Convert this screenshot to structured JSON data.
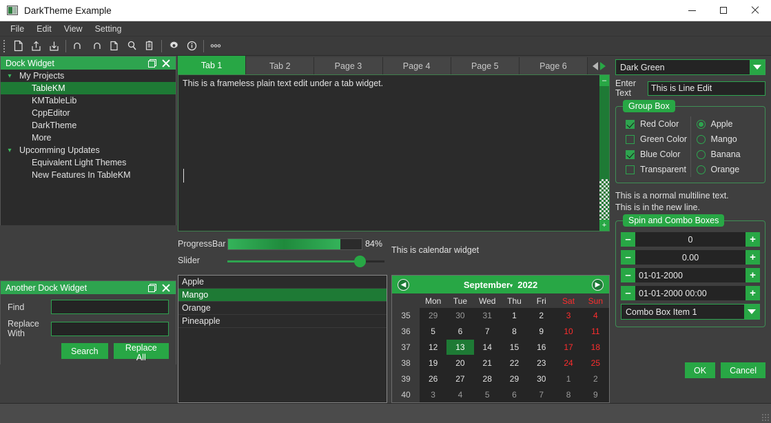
{
  "window": {
    "title": "DarkTheme Example",
    "app_icon": "app-icon",
    "minimize": "minimize-icon",
    "maximize": "maximize-icon",
    "close": "close-icon"
  },
  "menubar": {
    "items": [
      "File",
      "Edit",
      "View",
      "Setting"
    ]
  },
  "toolbar": {
    "icons": [
      "new-file-icon",
      "upload-icon",
      "download-icon",
      "undo-icon",
      "redo-icon",
      "copy-icon",
      "search-icon",
      "paste-icon",
      "gear-icon",
      "info-icon",
      "more-icon"
    ]
  },
  "dock_projects": {
    "title": "Dock Widget",
    "tree": [
      {
        "label": "My Projects",
        "level": 0,
        "expanded": true,
        "selected": false
      },
      {
        "label": "TableKM",
        "level": 1,
        "expanded": false,
        "selected": true
      },
      {
        "label": "KMTableLib",
        "level": 1,
        "expanded": false,
        "selected": false
      },
      {
        "label": "CppEditor",
        "level": 1,
        "expanded": false,
        "selected": false
      },
      {
        "label": "DarkTheme",
        "level": 1,
        "expanded": false,
        "selected": false
      },
      {
        "label": "More",
        "level": 1,
        "expanded": false,
        "selected": false
      },
      {
        "label": "Upcomming Updates",
        "level": 0,
        "expanded": true,
        "selected": false
      },
      {
        "label": "Equivalent Light Themes",
        "level": 1,
        "expanded": false,
        "selected": false
      },
      {
        "label": "New Features In TableKM",
        "level": 1,
        "expanded": false,
        "selected": false
      }
    ]
  },
  "dock_find": {
    "title": "Another Dock Widget",
    "find_label": "Find",
    "find_value": "",
    "replace_label": "Replace With",
    "replace_value": "",
    "search_button": "Search",
    "replace_all_button": "Replace All"
  },
  "tabs": {
    "items": [
      {
        "label": "Tab 1",
        "active": true
      },
      {
        "label": "Tab 2",
        "active": false
      },
      {
        "label": "Page 3",
        "active": false
      },
      {
        "label": "Page 4",
        "active": false
      },
      {
        "label": "Page 5",
        "active": false
      },
      {
        "label": "Page 6",
        "active": false
      }
    ],
    "nav_prev": "tab-scroll-left-icon",
    "nav_next": "tab-scroll-right-icon"
  },
  "text_edit": {
    "content": "This is a frameless plain text edit under a tab widget."
  },
  "scrollbar": {
    "decrement": "–",
    "increment": "+"
  },
  "progress": {
    "label": "ProgressBar",
    "value": 84,
    "value_text": "84%"
  },
  "slider": {
    "label": "Slider",
    "value": 84
  },
  "calendar_caption": "This is  calendar widget",
  "list_widget": {
    "items": [
      {
        "label": "Apple",
        "selected": false
      },
      {
        "label": "Mango",
        "selected": true
      },
      {
        "label": "Orange",
        "selected": false
      },
      {
        "label": "Pineapple",
        "selected": false
      }
    ]
  },
  "calendar": {
    "prev_icon": "calendar-prev-icon",
    "next_icon": "calendar-next-icon",
    "month": "September",
    "year": "2022",
    "day_headers": [
      "Mon",
      "Tue",
      "Wed",
      "Thu",
      "Fri",
      "Sat",
      "Sun"
    ],
    "weekend_headers": [
      "Sat",
      "Sun"
    ],
    "selected_day": 13,
    "weeks": [
      {
        "week": "35",
        "days": [
          {
            "d": "29",
            "out": true,
            "we": false
          },
          {
            "d": "30",
            "out": true,
            "we": false
          },
          {
            "d": "31",
            "out": true,
            "we": false
          },
          {
            "d": "1",
            "out": false,
            "we": false
          },
          {
            "d": "2",
            "out": false,
            "we": false
          },
          {
            "d": "3",
            "out": false,
            "we": true
          },
          {
            "d": "4",
            "out": false,
            "we": true
          }
        ]
      },
      {
        "week": "36",
        "days": [
          {
            "d": "5",
            "out": false,
            "we": false
          },
          {
            "d": "6",
            "out": false,
            "we": false
          },
          {
            "d": "7",
            "out": false,
            "we": false
          },
          {
            "d": "8",
            "out": false,
            "we": false
          },
          {
            "d": "9",
            "out": false,
            "we": false
          },
          {
            "d": "10",
            "out": false,
            "we": true
          },
          {
            "d": "11",
            "out": false,
            "we": true
          }
        ]
      },
      {
        "week": "37",
        "days": [
          {
            "d": "12",
            "out": false,
            "we": false
          },
          {
            "d": "13",
            "out": false,
            "we": false,
            "sel": true
          },
          {
            "d": "14",
            "out": false,
            "we": false
          },
          {
            "d": "15",
            "out": false,
            "we": false
          },
          {
            "d": "16",
            "out": false,
            "we": false
          },
          {
            "d": "17",
            "out": false,
            "we": true
          },
          {
            "d": "18",
            "out": false,
            "we": true
          }
        ]
      },
      {
        "week": "38",
        "days": [
          {
            "d": "19",
            "out": false,
            "we": false
          },
          {
            "d": "20",
            "out": false,
            "we": false
          },
          {
            "d": "21",
            "out": false,
            "we": false
          },
          {
            "d": "22",
            "out": false,
            "we": false
          },
          {
            "d": "23",
            "out": false,
            "we": false
          },
          {
            "d": "24",
            "out": false,
            "we": true
          },
          {
            "d": "25",
            "out": false,
            "we": true
          }
        ]
      },
      {
        "week": "39",
        "days": [
          {
            "d": "26",
            "out": false,
            "we": false
          },
          {
            "d": "27",
            "out": false,
            "we": false
          },
          {
            "d": "28",
            "out": false,
            "we": false
          },
          {
            "d": "29",
            "out": false,
            "we": false
          },
          {
            "d": "30",
            "out": false,
            "we": false
          },
          {
            "d": "1",
            "out": true,
            "we": false
          },
          {
            "d": "2",
            "out": true,
            "we": false
          }
        ]
      },
      {
        "week": "40",
        "days": [
          {
            "d": "3",
            "out": true,
            "we": false
          },
          {
            "d": "4",
            "out": true,
            "we": false
          },
          {
            "d": "5",
            "out": true,
            "we": false
          },
          {
            "d": "6",
            "out": true,
            "we": false
          },
          {
            "d": "7",
            "out": true,
            "we": false
          },
          {
            "d": "8",
            "out": true,
            "we": false
          },
          {
            "d": "9",
            "out": true,
            "we": false
          }
        ]
      }
    ]
  },
  "right_panel": {
    "theme_combo": {
      "value": "Dark Green"
    },
    "line_edit": {
      "label": "Enter Text",
      "value": "This is Line Edit"
    },
    "group_box": {
      "title": "Group Box",
      "checkboxes": [
        {
          "label": "Red Color",
          "checked": true
        },
        {
          "label": "Green Color",
          "checked": false
        },
        {
          "label": "Blue Color",
          "checked": true
        },
        {
          "label": "Transparent",
          "checked": false
        }
      ],
      "radios": [
        {
          "label": "Apple",
          "checked": true
        },
        {
          "label": "Mango",
          "checked": false
        },
        {
          "label": "Banana",
          "checked": false
        },
        {
          "label": "Orange",
          "checked": false
        }
      ]
    },
    "multiline_text_1": "This is a normal multiline text.",
    "multiline_text_2": "This is in the new line.",
    "spin_group": {
      "title": "Spin and Combo Boxes",
      "spins": [
        {
          "value": "0",
          "align": "center"
        },
        {
          "value": "0.00",
          "align": "center"
        },
        {
          "value": "01-01-2000",
          "align": "left"
        },
        {
          "value": "01-01-2000 00:00",
          "align": "left"
        }
      ],
      "decrement": "–",
      "increment": "+",
      "combo": {
        "value": "Combo Box Item 1"
      }
    },
    "ok_button": "OK",
    "cancel_button": "Cancel"
  },
  "colors": {
    "accent": "#28a745",
    "accent_dark": "#1e7a35",
    "window_bg": "#3f3f3f",
    "panel_bg": "#2b2b2b",
    "weekend": "#ff2d2d",
    "text": "#e2e2e2"
  }
}
